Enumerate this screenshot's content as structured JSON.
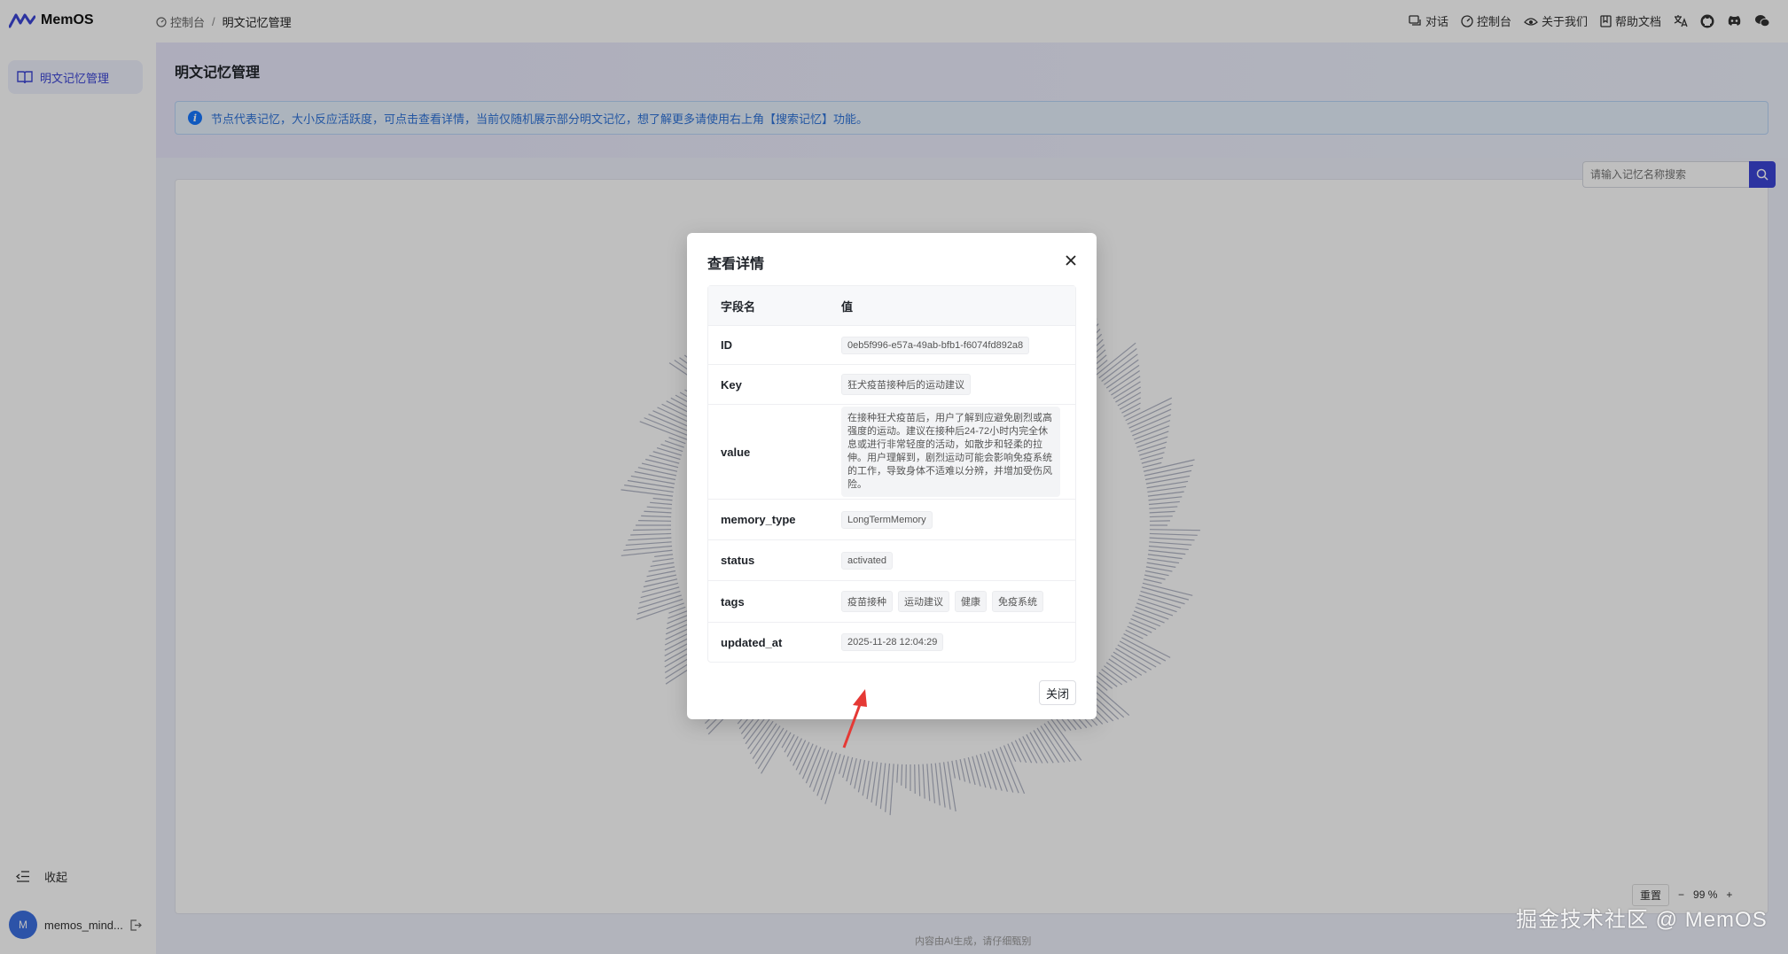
{
  "app": {
    "name": "MemOS"
  },
  "breadcrumb": {
    "parent": "控制台",
    "separator": "/",
    "current": "明文记忆管理"
  },
  "topnav": [
    {
      "label": "对话",
      "icon": "chat-icon"
    },
    {
      "label": "控制台",
      "icon": "dashboard-icon"
    },
    {
      "label": "关于我们",
      "icon": "about-icon"
    },
    {
      "label": "帮助文档",
      "icon": "book-icon"
    }
  ],
  "sidebar": {
    "items": [
      {
        "label": "明文记忆管理",
        "icon": "book-open-icon"
      }
    ],
    "collapse_label": "收起",
    "user": {
      "avatar_initial": "M",
      "name": "memos_mind..."
    }
  },
  "main": {
    "title": "明文记忆管理",
    "info": "节点代表记忆，大小反应活跃度，可点击查看详情，当前仅随机展示部分明文记忆，想了解更多请使用右上角【搜索记忆】功能。",
    "search_placeholder": "请输入记忆名称搜索",
    "zoom": {
      "reset_label": "重置",
      "minus": "−",
      "level": "99 %",
      "plus": "+"
    },
    "footer_note": "内容由AI生成，请仔细甄别"
  },
  "modal": {
    "title": "查看详情",
    "columns": {
      "field": "字段名",
      "value": "值"
    },
    "fields": {
      "id": {
        "key": "ID",
        "value": "0eb5f996-e57a-49ab-bfb1-f6074fd892a8"
      },
      "key": {
        "key": "Key",
        "value": "狂犬疫苗接种后的运动建议"
      },
      "value": {
        "key": "value",
        "value": "在接种狂犬疫苗后，用户了解到应避免剧烈或高强度的运动。建议在接种后24-72小时内完全休息或进行非常轻度的活动，如散步和轻柔的拉伸。用户理解到，剧烈运动可能会影响免疫系统的工作，导致身体不适难以分辨，并增加受伤风险。"
      },
      "memory_type": {
        "key": "memory_type",
        "value": "LongTermMemory"
      },
      "status": {
        "key": "status",
        "value": "activated"
      },
      "tags": {
        "key": "tags",
        "values": [
          "疫苗接种",
          "运动建议",
          "健康",
          "免疫系统"
        ]
      },
      "updated_at": {
        "key": "updated_at",
        "value": "2025-11-28 12:04:29"
      }
    },
    "close_label": "关闭"
  },
  "watermark": "掘金技术社区 @ MemOS",
  "colors": {
    "accent": "#3b45d6",
    "info_text": "#2f73d9",
    "annotation_arrow": "#e53935"
  }
}
